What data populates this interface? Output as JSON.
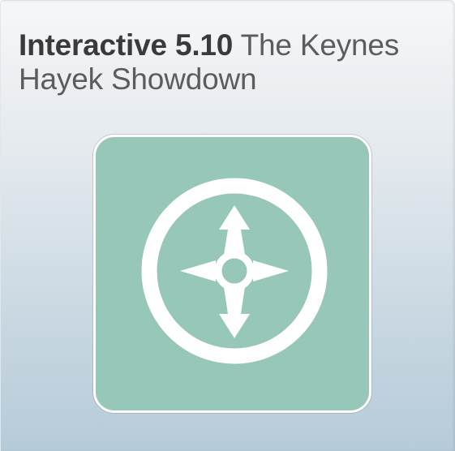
{
  "widget": {
    "label": "Interactive 5.10",
    "title": "The Keynes Hayek Showdown",
    "icon": "compass-icon",
    "colors": {
      "tile": "#96c7b9",
      "glyph": "#ffffff",
      "label_text": "#3a3a3a",
      "title_text": "#5c5c5c"
    }
  }
}
